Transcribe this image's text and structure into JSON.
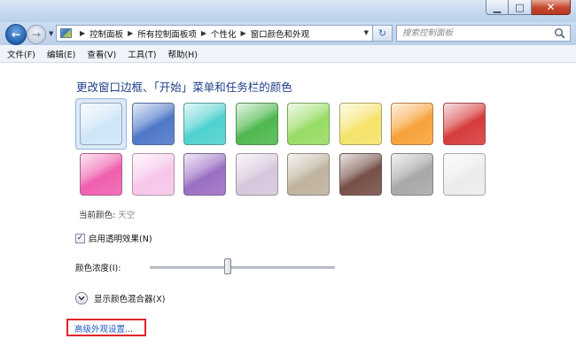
{
  "window": {
    "minimize_glyph": "▁",
    "maximize_glyph": "□",
    "close_glyph": "✕"
  },
  "address_bar": {
    "breadcrumbs": [
      "控制面板",
      "所有控制面板项",
      "个性化",
      "窗口颜色和外观"
    ]
  },
  "search": {
    "placeholder": "搜索控制面板"
  },
  "menu": {
    "items": [
      "文件(F)",
      "编辑(E)",
      "查看(V)",
      "工具(T)",
      "帮助(H)"
    ]
  },
  "page": {
    "title": "更改窗口边框、「开始」菜单和任务栏的颜色",
    "current_color_label": "当前颜色:",
    "current_color_value": "天空",
    "transparency_label": "启用透明效果(N)",
    "transparency_checked": true,
    "intensity_label": "颜色浓度(I):",
    "intensity_level_percent": 42,
    "mixer_label": "显示颜色混合器(X)",
    "advanced_link": "高级外观设置..."
  },
  "swatches": [
    {
      "color": "#cfe6f9",
      "selected": true
    },
    {
      "color": "#4f78c8",
      "selected": false
    },
    {
      "color": "#4fd1cf",
      "selected": false
    },
    {
      "color": "#4fb84f",
      "selected": false
    },
    {
      "color": "#98dc64",
      "selected": false
    },
    {
      "color": "#f5e36a",
      "selected": false
    },
    {
      "color": "#f7a23a",
      "selected": false
    },
    {
      "color": "#d63c3c",
      "selected": false
    },
    {
      "color": "#ef5fae",
      "selected": false
    },
    {
      "color": "#f7c6ea",
      "selected": false
    },
    {
      "color": "#9a6fc3",
      "selected": false
    },
    {
      "color": "#d8c6dc",
      "selected": false
    },
    {
      "color": "#bfb29e",
      "selected": false
    },
    {
      "color": "#765048",
      "selected": false
    },
    {
      "color": "#a8a8a8",
      "selected": false
    },
    {
      "color": "#ececec",
      "selected": false
    }
  ]
}
